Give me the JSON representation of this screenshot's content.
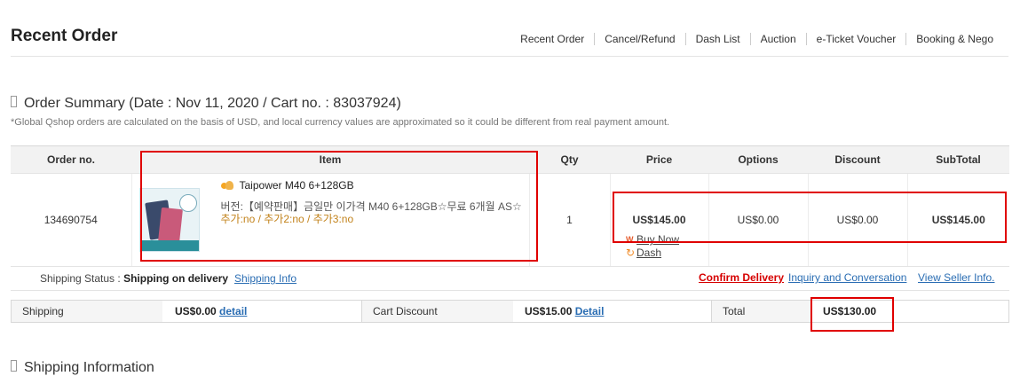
{
  "page_title": "Recent Order",
  "topnav": [
    "Recent Order",
    "Cancel/Refund",
    "Dash List",
    "Auction",
    "e-Ticket Voucher",
    "Booking & Nego"
  ],
  "summary": {
    "heading": "Order Summary (Date : Nov 11, 2020 / Cart no. : 83037924)",
    "note": "*Global Qshop orders are calculated on the basis of USD, and local currency values are approximated so it could be different from real payment amount."
  },
  "table": {
    "headers": [
      "Order no.",
      "Item",
      "Qty",
      "Price",
      "Options",
      "Discount",
      "SubTotal"
    ],
    "row": {
      "order_no": "134690754",
      "item_name": "Taipower M40 6+128GB",
      "item_desc": "버전:【예약판매】금일만 이가격 M40 6+128GB☆무료 6개월 AS☆",
      "item_options": "추가:no / 추가2:no / 추가3:no",
      "qty": "1",
      "price": "US$145.00",
      "options": "US$0.00",
      "discount": "US$0.00",
      "subtotal": "US$145.00"
    },
    "actions": {
      "buy_now": "Buy Now",
      "dash": "Dash"
    }
  },
  "shipping_status": {
    "label": "Shipping Status :",
    "value": "Shipping on delivery",
    "info_link": "Shipping Info",
    "confirm": "Confirm Delivery",
    "inquiry": "Inquiry and Conversation",
    "view_seller": "View Seller Info."
  },
  "totals": {
    "shipping_label": "Shipping",
    "shipping_value": "US$0.00",
    "shipping_detail": "detail",
    "cart_discount_label": "Cart Discount",
    "cart_discount_value": "US$15.00",
    "cart_discount_detail": "Detail",
    "total_label": "Total",
    "total_value": "US$130.00"
  },
  "shipping_info_heading": "Shipping Information",
  "colors": {
    "highlight": "#e00000",
    "link": "#2a6db3",
    "confirm": "#d60000",
    "option": "#c2821a"
  }
}
